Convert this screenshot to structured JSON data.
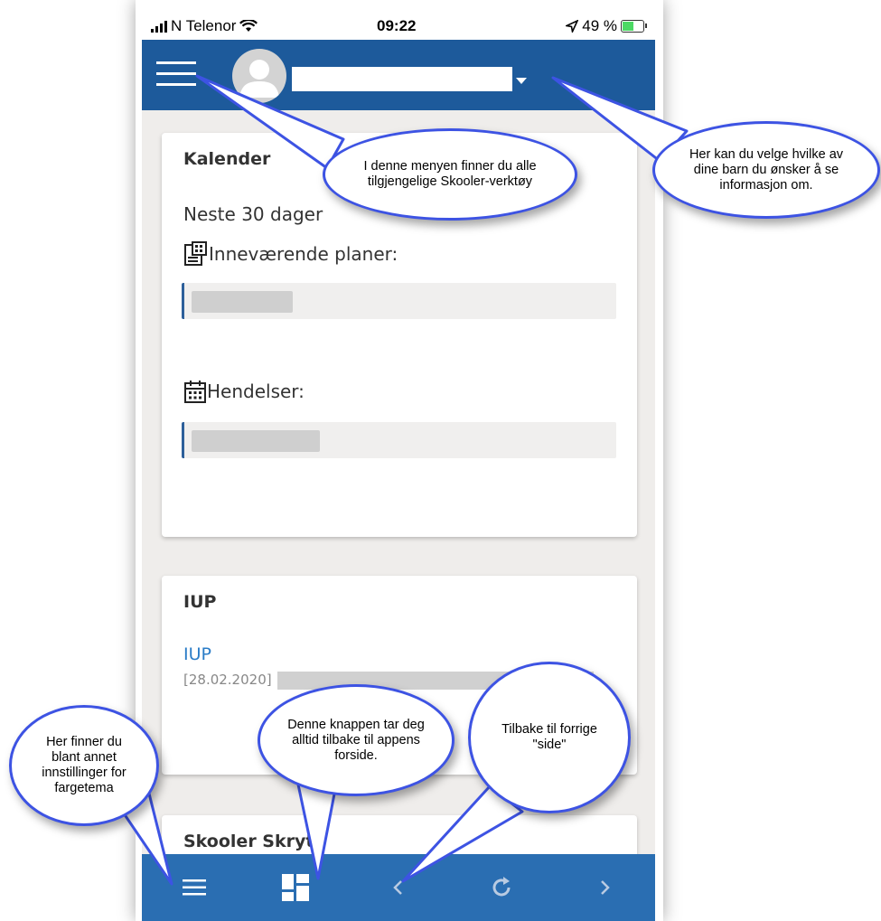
{
  "status_bar": {
    "carrier": "N Telenor",
    "time": "09:22",
    "battery": "49 %"
  },
  "header": {
    "menu_icon": "hamburger-menu-icon",
    "avatar_icon": "user-avatar-icon",
    "dropdown_icon": "caret-down-icon"
  },
  "calendar_card": {
    "title": "Kalender",
    "range": "Neste 30 dager",
    "plans_label": "Inneværende planer:",
    "events_label": "Hendelser:"
  },
  "iup_card": {
    "title": "IUP",
    "link": "IUP",
    "date": "[28.02.2020]"
  },
  "skryt_card": {
    "title": "Skooler Skryt"
  },
  "tab_bar": {
    "items": [
      "menu-icon",
      "dashboard-icon",
      "chevron-left-icon",
      "refresh-icon",
      "chevron-right-icon"
    ]
  },
  "callouts": {
    "menu": "I denne menyen finner du alle tilgjengelige Skooler-verktøy",
    "child": "Her kan du velge hvilke av dine barn du ønsker å se informasjon om.",
    "settings": "Her finner du blant annet innstillinger for fargetema",
    "home": "Denne knappen tar deg alltid tilbake til appens forside.",
    "back": "Tilbake til forrige \"side\""
  },
  "colors": {
    "header": "#1d5a9b",
    "tab_bar": "#2a6eb2",
    "link": "#2a7cc7",
    "callout_border": "#3d53e3"
  }
}
